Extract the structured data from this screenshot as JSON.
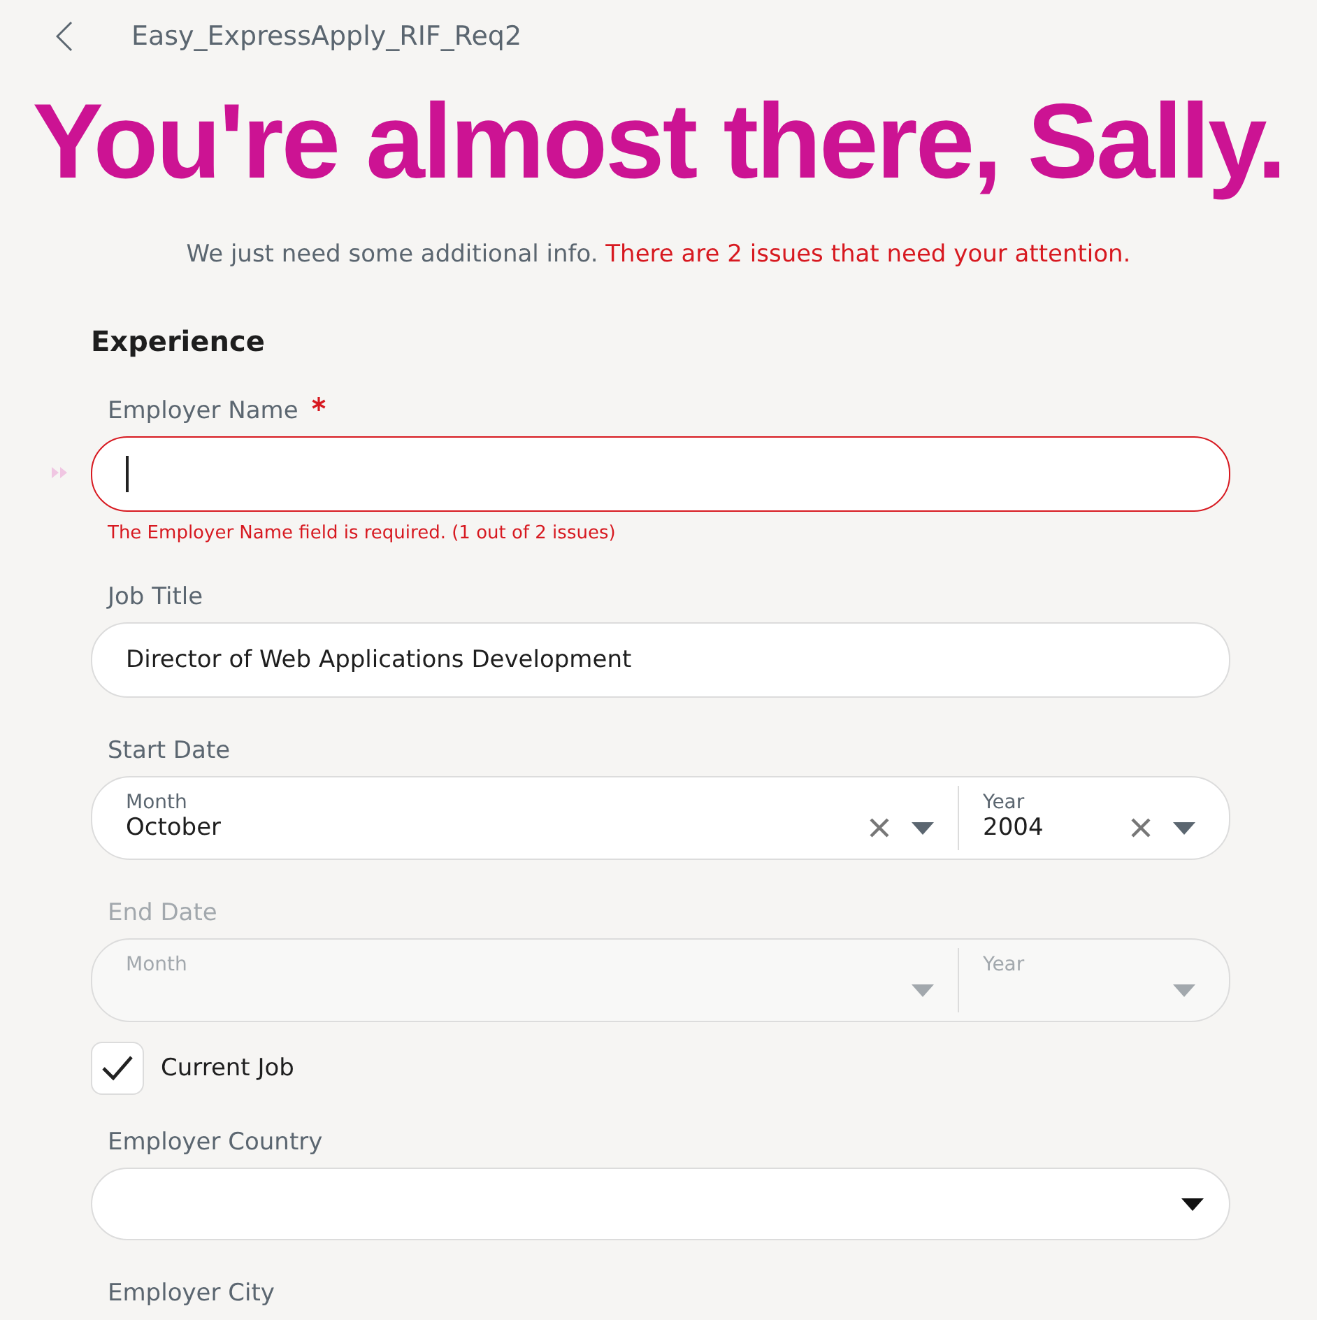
{
  "header": {
    "title": "Easy_ExpressApply_RIF_Req2"
  },
  "heading": "You're almost there, Sally.",
  "intro": {
    "text": "We just need some additional info.",
    "alert": "There are 2 issues that need your attention."
  },
  "section": {
    "title": "Experience"
  },
  "fields": [
    {
      "kind": "text",
      "label": "Employer Name",
      "required": true,
      "focused": true,
      "error": "The Employer Name field is required. (1 out of 2 issues)"
    },
    {
      "kind": "text",
      "label": "Job Title",
      "required": false,
      "focused": false,
      "value": "Director of Web Applications Development"
    },
    {
      "kind": "date",
      "label": "Start Date",
      "disabled": false,
      "month": {
        "label": "Month",
        "value": "October"
      },
      "year": {
        "label": "Year",
        "value": "2004"
      }
    },
    {
      "kind": "date",
      "label": "End Date",
      "disabled": true,
      "month": {
        "label": "Month"
      },
      "year": {
        "label": "Year"
      }
    },
    {
      "kind": "checkbox",
      "label": "Current Job",
      "checked": true
    },
    {
      "kind": "select",
      "label": "Employer Country"
    },
    {
      "kind": "label",
      "label": "Employer City"
    }
  ]
}
